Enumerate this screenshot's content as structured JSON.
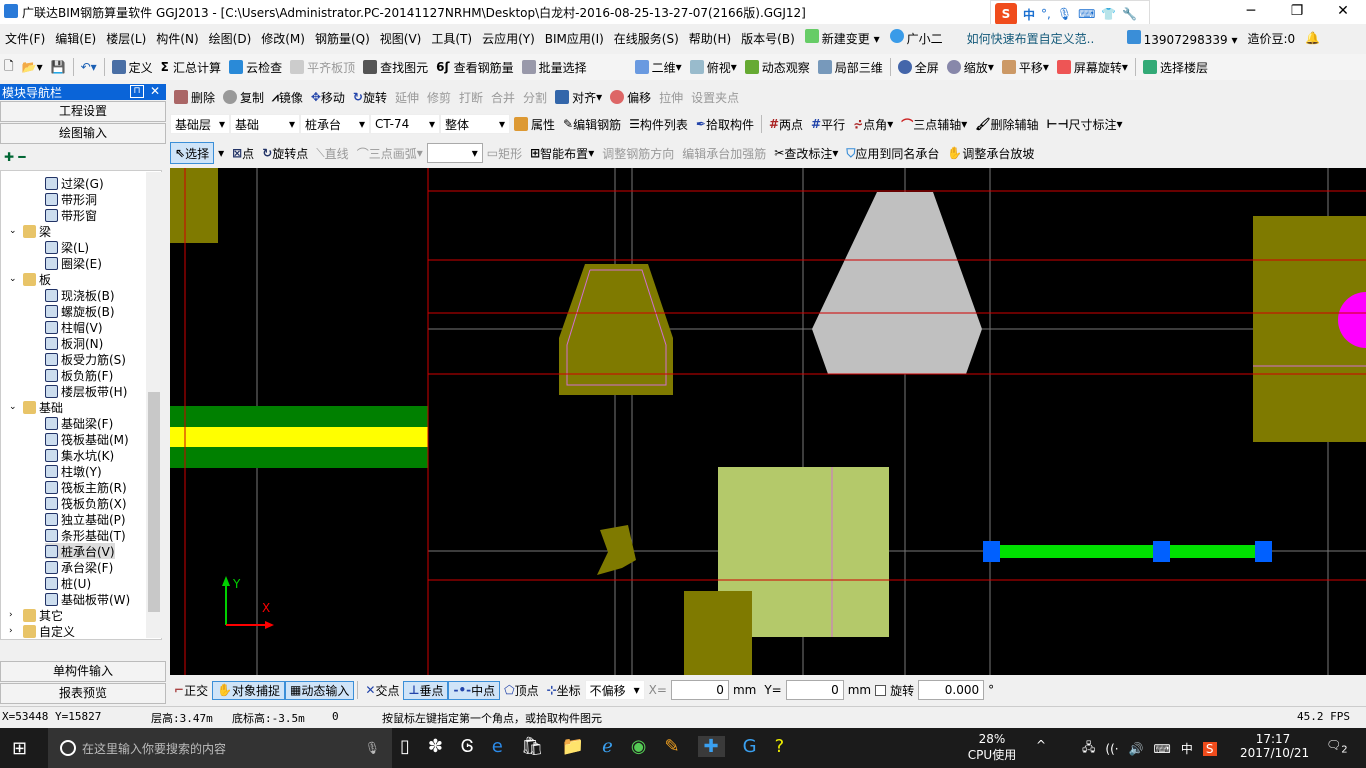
{
  "title": "广联达BIM钢筋算量软件 GGJ2013 - [C:\\Users\\Administrator.PC-20141127NRHM\\Desktop\\白龙村-2016-08-25-13-27-07(2166版).GGJ12]",
  "ime": {
    "lang": "中",
    "punct": "°,"
  },
  "menu": [
    "文件(F)",
    "编辑(E)",
    "楼层(L)",
    "构件(N)",
    "绘图(D)",
    "修改(M)",
    "钢筋量(Q)",
    "视图(V)",
    "工具(T)",
    "云应用(Y)",
    "BIM应用(I)",
    "在线服务(S)",
    "帮助(H)",
    "版本号(B)"
  ],
  "menu_extra": {
    "new_change": "新建变更",
    "assistant": "广小二",
    "tip": "如何快速布置自定义范..",
    "phone": "13907298339",
    "beans": "造价豆:0"
  },
  "toolbar1": [
    "定义",
    "汇总计算",
    "云检查",
    "平齐板顶",
    "查找图元",
    "查看钢筋量",
    "批量选择"
  ],
  "toolbar1b": [
    "二维",
    "俯视",
    "动态观察",
    "局部三维",
    "全屏",
    "缩放",
    "平移",
    "屏幕旋转",
    "选择楼层"
  ],
  "toolbar2": [
    "删除",
    "复制",
    "镜像",
    "移动",
    "旋转",
    "延伸",
    "修剪",
    "打断",
    "合并",
    "分割",
    "对齐",
    "偏移",
    "拉伸",
    "设置夹点"
  ],
  "selectors": {
    "floor": "基础层",
    "category": "基础",
    "type": "桩承台",
    "component": "CT-74",
    "mode": "整体"
  },
  "toolbar3": [
    "属性",
    "编辑钢筋",
    "构件列表",
    "拾取构件",
    "两点",
    "平行",
    "点角",
    "三点辅轴",
    "删除辅轴",
    "尺寸标注"
  ],
  "toolbar4": [
    "选择",
    "点",
    "旋转点",
    "直线",
    "三点画弧",
    "矩形",
    "智能布置",
    "调整钢筋方向",
    "编辑承台加强筋",
    "查改标注",
    "应用到同名承台",
    "调整承台放坡"
  ],
  "nav": {
    "title": "模块导航栏",
    "project_settings": "工程设置",
    "draw_input": "绘图输入",
    "single_input": "单构件输入",
    "report": "报表预览"
  },
  "tree": [
    {
      "label": "过梁(G)",
      "level": 2
    },
    {
      "label": "带形洞",
      "level": 2
    },
    {
      "label": "带形窗",
      "level": 2
    },
    {
      "label": "梁",
      "level": 1
    },
    {
      "label": "梁(L)",
      "level": 2
    },
    {
      "label": "圈梁(E)",
      "level": 2
    },
    {
      "label": "板",
      "level": 1
    },
    {
      "label": "现浇板(B)",
      "level": 2
    },
    {
      "label": "螺旋板(B)",
      "level": 2
    },
    {
      "label": "柱帽(V)",
      "level": 2
    },
    {
      "label": "板洞(N)",
      "level": 2
    },
    {
      "label": "板受力筋(S)",
      "level": 2
    },
    {
      "label": "板负筋(F)",
      "level": 2
    },
    {
      "label": "楼层板带(H)",
      "level": 2
    },
    {
      "label": "基础",
      "level": 1
    },
    {
      "label": "基础梁(F)",
      "level": 2
    },
    {
      "label": "筏板基础(M)",
      "level": 2
    },
    {
      "label": "集水坑(K)",
      "level": 2
    },
    {
      "label": "柱墩(Y)",
      "level": 2
    },
    {
      "label": "筏板主筋(R)",
      "level": 2
    },
    {
      "label": "筏板负筋(X)",
      "level": 2
    },
    {
      "label": "独立基础(P)",
      "level": 2
    },
    {
      "label": "条形基础(T)",
      "level": 2
    },
    {
      "label": "桩承台(V)",
      "level": 2,
      "selected": true
    },
    {
      "label": "承台梁(F)",
      "level": 2
    },
    {
      "label": "桩(U)",
      "level": 2
    },
    {
      "label": "基础板带(W)",
      "level": 2
    },
    {
      "label": "其它",
      "level": 1
    },
    {
      "label": "自定义",
      "level": 1
    }
  ],
  "axis": {
    "x": "X",
    "y": "Y"
  },
  "snapbar": {
    "items": [
      "正交",
      "对象捕捉",
      "动态输入",
      "交点",
      "垂点",
      "中点",
      "顶点",
      "坐标"
    ],
    "offset": "不偏移",
    "x_label": "X=",
    "x": "0",
    "y_label": "Y=",
    "y": "0",
    "unit": "mm",
    "rotate": "旋转",
    "angle": "0.000",
    "deg": "°"
  },
  "status": {
    "coords": "X=53448 Y=15827",
    "floor_height": "层高:3.47m",
    "bottom": "底标高:-3.5m",
    "zero": "0",
    "hint": "按鼠标左键指定第一个角点，或拾取构件图元",
    "fps": "45.2 FPS"
  },
  "taskbar": {
    "search": "在这里输入你要搜索的内容",
    "cpu": "28%",
    "cpu_label": "CPU使用",
    "ime": "中",
    "time": "17:17",
    "date": "2017/10/21",
    "notif": "2"
  },
  "colors": {
    "canvas": "#000000",
    "olive": "#7f7a00",
    "slab": "#b4c96a",
    "red_axis": "#d00000",
    "green": "#00a000",
    "yellow": "#ffff00",
    "blue": "#0060ff",
    "magenta": "#ff00ff",
    "gray": "#c0c0c0"
  }
}
